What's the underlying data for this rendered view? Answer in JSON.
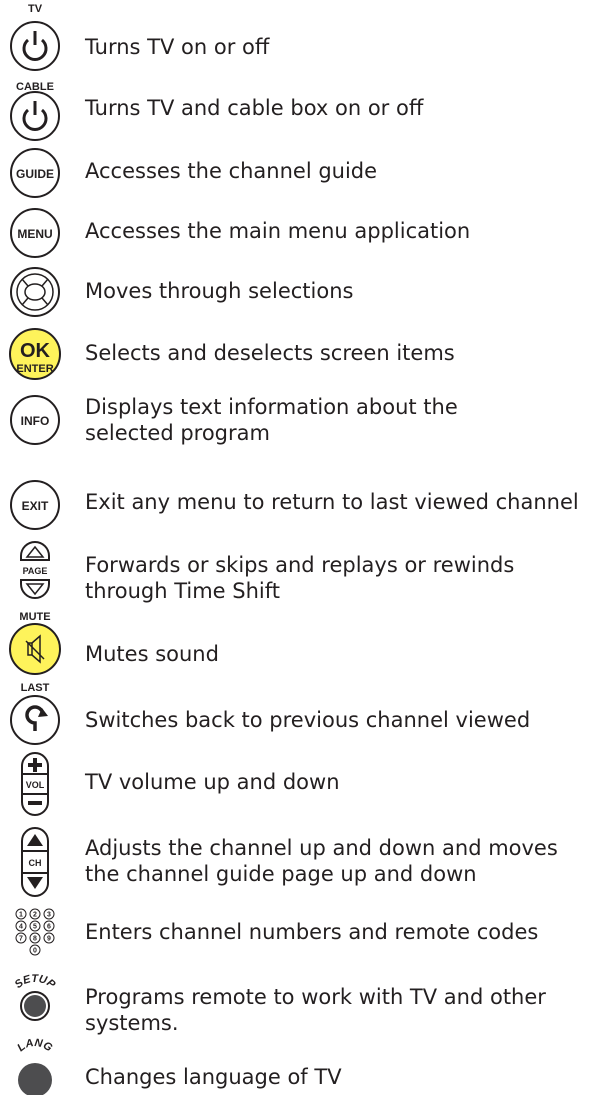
{
  "colors": {
    "yellow": "#fef35b",
    "outline": "#231f20",
    "dark_fill": "#4d4d4f"
  },
  "items": [
    {
      "key": "tv_power",
      "icon": "power-icon",
      "label": "TV",
      "desc_lines": [
        "Turns TV on or off"
      ]
    },
    {
      "key": "cable_power",
      "icon": "power-icon",
      "label": "CABLE",
      "desc_lines": [
        "Turns TV and cable box on or off"
      ]
    },
    {
      "key": "guide",
      "icon": "guide-button-icon",
      "label": "GUIDE",
      "desc_lines": [
        "Accesses the channel guide"
      ]
    },
    {
      "key": "menu",
      "icon": "menu-button-icon",
      "label": "MENU",
      "desc_lines": [
        "Accesses the main menu application"
      ]
    },
    {
      "key": "navigation",
      "icon": "navigation-pad-icon",
      "label": "",
      "desc_lines": [
        "Moves through selections"
      ]
    },
    {
      "key": "ok_enter",
      "icon": "ok-enter-button-icon",
      "label": "OK",
      "sub_label": "ENTER",
      "desc_lines": [
        "Selects and deselects screen items"
      ]
    },
    {
      "key": "info",
      "icon": "info-button-icon",
      "label": "INFO",
      "desc_lines": [
        "Displays text information about the",
        "selected program"
      ]
    },
    {
      "key": "exit",
      "icon": "exit-button-icon",
      "label": "EXIT",
      "desc_lines": [
        "Exit any menu to return to last viewed channel"
      ]
    },
    {
      "key": "page",
      "icon": "page-rocker-icon",
      "label": "PAGE",
      "desc_lines": [
        "Forwards or skips and replays or rewinds",
        "through Time Shift"
      ]
    },
    {
      "key": "mute",
      "icon": "mute-speaker-icon",
      "label": "MUTE",
      "desc_lines": [
        "Mutes sound"
      ]
    },
    {
      "key": "last",
      "icon": "last-channel-icon",
      "label": "LAST",
      "desc_lines": [
        "Switches back to previous channel viewed"
      ]
    },
    {
      "key": "vol",
      "icon": "volume-rocker-icon",
      "label": "VOL",
      "desc_lines": [
        "TV volume up and down"
      ]
    },
    {
      "key": "ch",
      "icon": "channel-rocker-icon",
      "label": "CH",
      "desc_lines": [
        "Adjusts the channel up and down and moves",
        "the channel guide page up and down"
      ]
    },
    {
      "key": "numbers",
      "icon": "number-pad-icon",
      "label": "",
      "digits": [
        "1",
        "2",
        "3",
        "4",
        "5",
        "6",
        "7",
        "8",
        "9",
        "0"
      ],
      "desc_lines": [
        "Enters channel numbers and remote codes"
      ]
    },
    {
      "key": "setup",
      "icon": "setup-button-icon",
      "label": "SETUP",
      "desc_lines": [
        "Programs remote to work with TV and other",
        "systems."
      ]
    },
    {
      "key": "lang",
      "icon": "lang-button-icon",
      "label": "LANG",
      "desc_lines": [
        "Changes language of TV"
      ]
    }
  ]
}
